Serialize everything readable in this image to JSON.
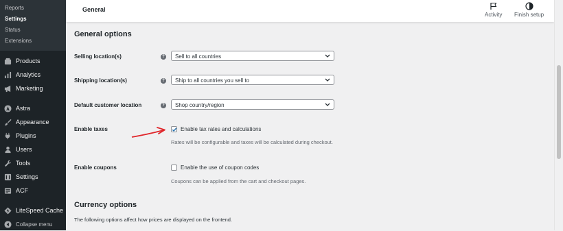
{
  "sidebar": {
    "submenu": [
      {
        "label": "Reports",
        "active": false
      },
      {
        "label": "Settings",
        "active": true
      },
      {
        "label": "Status",
        "active": false
      },
      {
        "label": "Extensions",
        "active": false
      }
    ],
    "items": [
      {
        "label": "Products",
        "icon": "products-icon"
      },
      {
        "label": "Analytics",
        "icon": "analytics-icon"
      },
      {
        "label": "Marketing",
        "icon": "megaphone-icon"
      },
      {
        "label": "Astra",
        "icon": "astra-icon"
      },
      {
        "label": "Appearance",
        "icon": "paintbrush-icon"
      },
      {
        "label": "Plugins",
        "icon": "plug-icon"
      },
      {
        "label": "Users",
        "icon": "users-icon"
      },
      {
        "label": "Tools",
        "icon": "wrench-icon"
      },
      {
        "label": "Settings",
        "icon": "settings-icon"
      },
      {
        "label": "ACF",
        "icon": "acf-icon"
      },
      {
        "label": "LiteSpeed Cache",
        "icon": "litespeed-icon"
      },
      {
        "label": "Collapse menu",
        "icon": "collapse-icon"
      }
    ]
  },
  "header": {
    "title": "General",
    "activity_label": "Activity",
    "finish_setup_label": "Finish setup"
  },
  "general_options": {
    "heading": "General options",
    "selling_location": {
      "label": "Selling location(s)",
      "value": "Sell to all countries"
    },
    "shipping_location": {
      "label": "Shipping location(s)",
      "value": "Ship to all countries you sell to"
    },
    "default_customer_location": {
      "label": "Default customer location",
      "value": "Shop country/region"
    },
    "enable_taxes": {
      "label": "Enable taxes",
      "checkbox_label": "Enable tax rates and calculations",
      "checked": true,
      "description": "Rates will be configurable and taxes will be calculated during checkout."
    },
    "enable_coupons": {
      "label": "Enable coupons",
      "checkbox_label": "Enable the use of coupon codes",
      "checked": false,
      "description": "Coupons can be applied from the cart and checkout pages."
    }
  },
  "currency_options": {
    "heading": "Currency options",
    "description": "The following options affect how prices are displayed on the frontend."
  },
  "colors": {
    "sidebar_bg": "#1d2327",
    "accent": "#2271b1",
    "annotation_arrow": "#e0262b"
  }
}
